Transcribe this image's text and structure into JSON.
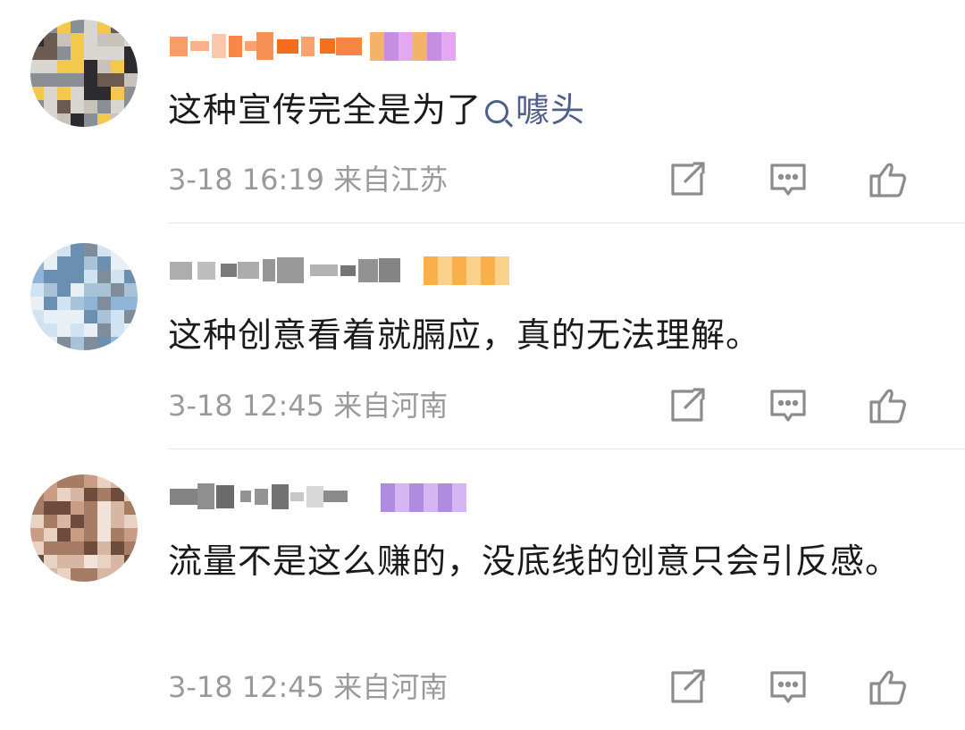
{
  "comments": [
    {
      "id": "c1",
      "content_text": "这种宣传完全是为了",
      "topic_link": "噱头",
      "time": "3-18 16:19",
      "location": "来自江苏",
      "avatar_colors": [
        "#d9d6d2",
        "#6b5a50",
        "#2c2c30",
        "#8a8f96",
        "#c8c2ba",
        "#f2c94c"
      ],
      "name_colors": [
        "#f56a1a",
        "#f8a070"
      ],
      "badge_colors": [
        "#f4b36a",
        "#c68ee0",
        "#e4a8f0"
      ]
    },
    {
      "id": "c2",
      "content_text": "这种创意看着就膈应，真的无法理解。",
      "time": "3-18 12:45",
      "location": "来自河南",
      "avatar_colors": [
        "#cfe3f2",
        "#8fb4d6",
        "#6a8fb0",
        "#e8f0f6",
        "#a8c2d8",
        "#808c99"
      ],
      "name_colors": [
        "#555555",
        "#aaaaaa"
      ],
      "badge_colors": [
        "#f9b04a",
        "#fbd08a"
      ]
    },
    {
      "id": "c3",
      "content_text": "流量不是这么赚的，没底线的创意只会引反感。",
      "time": "3-18 12:45",
      "location": "来自河南",
      "avatar_colors": [
        "#e8d2c4",
        "#a77c64",
        "#6d4b3d",
        "#f2e3da",
        "#c99d84",
        "#d8b6a4"
      ],
      "name_colors": [
        "#666666",
        "#b8b8b8"
      ],
      "badge_colors": [
        "#b08be0",
        "#d3b6f2"
      ]
    }
  ],
  "icons": {
    "share": "share-icon",
    "comment": "comment-icon",
    "like": "like-icon"
  },
  "colors": {
    "meta": "#9a9a9a",
    "link": "#4d5f8a",
    "text": "#1a1a1a"
  }
}
